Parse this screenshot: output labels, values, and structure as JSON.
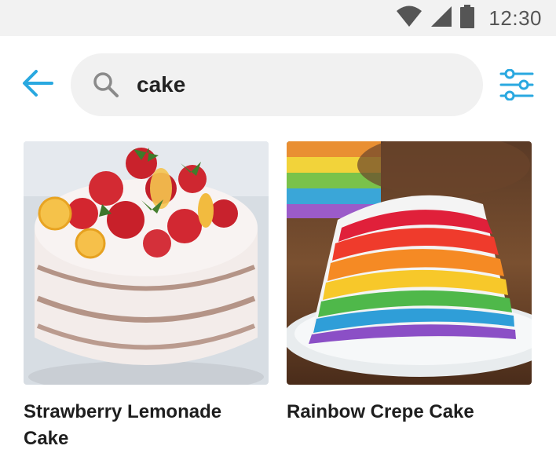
{
  "status_bar": {
    "time": "12:30",
    "icons": [
      "wifi-icon",
      "cell-signal-icon",
      "battery-icon"
    ]
  },
  "search": {
    "query": "cake",
    "icons": {
      "back": "arrow-left-icon",
      "search": "search-icon",
      "filter": "filter-sliders-icon"
    }
  },
  "results": [
    {
      "title": "Strawberry Lemonade Cake"
    },
    {
      "title": "Rainbow Crepe Cake"
    }
  ],
  "colors": {
    "accent": "#29a8e0",
    "status_bar_bg": "#f2f2f2",
    "search_bg": "#f1f1f1",
    "title_text": "#1e1e1e"
  }
}
